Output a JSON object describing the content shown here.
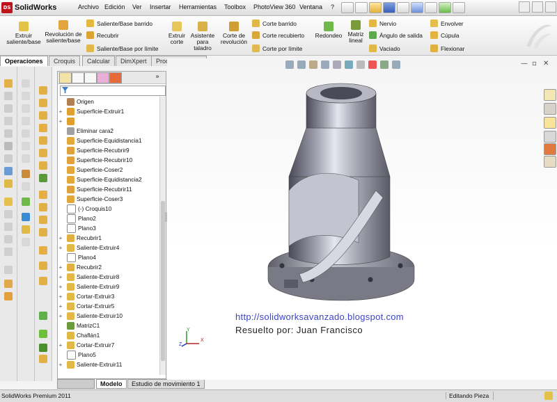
{
  "app": {
    "name": "SolidWorks",
    "logo_text": "DS"
  },
  "menu": [
    "Archivo",
    "Edición",
    "Ver",
    "Insertar",
    "Herramientas",
    "Toolbox",
    "PhotoView 360",
    "Ventana",
    "?"
  ],
  "ribbon": {
    "large": [
      {
        "label": "Extruir saliente/base",
        "icon": "extrude-boss-icon"
      },
      {
        "label": "Revolución de saliente/base",
        "icon": "revolve-boss-icon"
      },
      {
        "label": "Extruir corte",
        "icon": "extrude-cut-icon"
      },
      {
        "label": "Asistente para taladro",
        "icon": "hole-wizard-icon"
      },
      {
        "label": "Corte de revolución",
        "icon": "revolve-cut-icon"
      },
      {
        "label": "Redondeo",
        "icon": "fillet-icon"
      },
      {
        "label": "Matriz lineal",
        "icon": "linear-pattern-icon"
      }
    ],
    "small": [
      {
        "label": "Saliente/Base barrido",
        "icon": "swept-boss-icon"
      },
      {
        "label": "Recubrir",
        "icon": "loft-icon"
      },
      {
        "label": "Saliente/Base por límite",
        "icon": "boundary-boss-icon"
      },
      {
        "label": "Corte barrido",
        "icon": "swept-cut-icon"
      },
      {
        "label": "Corte recubierto",
        "icon": "lofted-cut-icon"
      },
      {
        "label": "Corte por límite",
        "icon": "boundary-cut-icon"
      },
      {
        "label": "Nervio",
        "icon": "rib-icon"
      },
      {
        "label": "Ángulo de salida",
        "icon": "draft-icon"
      },
      {
        "label": "Vaciado",
        "icon": "shell-icon"
      },
      {
        "label": "Envolver",
        "icon": "wrap-icon"
      },
      {
        "label": "Cúpula",
        "icon": "dome-icon"
      },
      {
        "label": "Flexionar",
        "icon": "flex-icon"
      }
    ]
  },
  "command_tabs": [
    "Operaciones",
    "Croquis",
    "Calcular",
    "DimXpert",
    "Productos Office"
  ],
  "feature_tree": [
    {
      "label": "Origen",
      "expand": "",
      "icon": "origin-icon"
    },
    {
      "label": "Superficie-Extruir1",
      "expand": "+",
      "icon": "surface-extrude-icon"
    },
    {
      "label": "",
      "expand": "+",
      "icon": "surface-icon"
    },
    {
      "label": "Eliminar cara2",
      "expand": "",
      "icon": "delete-face-icon"
    },
    {
      "label": "Superficie-Equidistancia1",
      "expand": "",
      "icon": "offset-surface-icon"
    },
    {
      "label": "Superficie-Recubrir9",
      "expand": "",
      "icon": "lofted-surface-icon"
    },
    {
      "label": "Superficie-Recubrir10",
      "expand": "",
      "icon": "lofted-surface-icon"
    },
    {
      "label": "Superficie-Coser2",
      "expand": "",
      "icon": "knit-surface-icon"
    },
    {
      "label": "Superficie-Equidistancia2",
      "expand": "",
      "icon": "offset-surface-icon"
    },
    {
      "label": "Superficie-Recubrir11",
      "expand": "",
      "icon": "lofted-surface-icon"
    },
    {
      "label": "Superficie-Coser3",
      "expand": "",
      "icon": "knit-surface-icon"
    },
    {
      "label": "(-) Croquis10",
      "expand": "",
      "icon": "sketch-icon"
    },
    {
      "label": "Plano2",
      "expand": "",
      "icon": "plane-icon"
    },
    {
      "label": "Plano3",
      "expand": "",
      "icon": "plane-icon"
    },
    {
      "label": "Recubrir1",
      "expand": "+",
      "icon": "loft-icon"
    },
    {
      "label": "Saliente-Extruir4",
      "expand": "+",
      "icon": "boss-extrude-icon"
    },
    {
      "label": "Plano4",
      "expand": "",
      "icon": "plane-icon"
    },
    {
      "label": "Recubrir2",
      "expand": "+",
      "icon": "loft-icon"
    },
    {
      "label": "Saliente-Extruir8",
      "expand": "+",
      "icon": "boss-extrude-icon"
    },
    {
      "label": "Saliente-Extruir9",
      "expand": "+",
      "icon": "boss-extrude-icon"
    },
    {
      "label": "Cortar-Extruir3",
      "expand": "+",
      "icon": "cut-extrude-icon"
    },
    {
      "label": "Cortar-Extruir5",
      "expand": "+",
      "icon": "cut-extrude-icon"
    },
    {
      "label": "Saliente-Extruir10",
      "expand": "+",
      "icon": "boss-extrude-icon"
    },
    {
      "label": "MatrizC1",
      "expand": "",
      "icon": "circular-pattern-icon"
    },
    {
      "label": "Chaflán1",
      "expand": "",
      "icon": "chamfer-icon"
    },
    {
      "label": "Cortar-Extruir7",
      "expand": "+",
      "icon": "cut-extrude-icon"
    },
    {
      "label": "Plano5",
      "expand": "",
      "icon": "plane-icon"
    },
    {
      "label": "Saliente-Extruir11",
      "expand": "+",
      "icon": "boss-extrude-icon"
    }
  ],
  "bottom_tabs": [
    "Modelo",
    "Estudio de movimiento 1"
  ],
  "status": {
    "product": "SolidWorks Premium 2011",
    "mode": "Editando Pieza"
  },
  "watermark": {
    "url": "http://solidworksavanzado.blogspot.com",
    "author": "Resuelto por: Juan Francisco"
  },
  "triad": {
    "x": "X",
    "y": "Y",
    "z": "Z"
  },
  "colors": {
    "url": "#3a44c8",
    "author": "#222222",
    "accent": "#c0141c"
  }
}
